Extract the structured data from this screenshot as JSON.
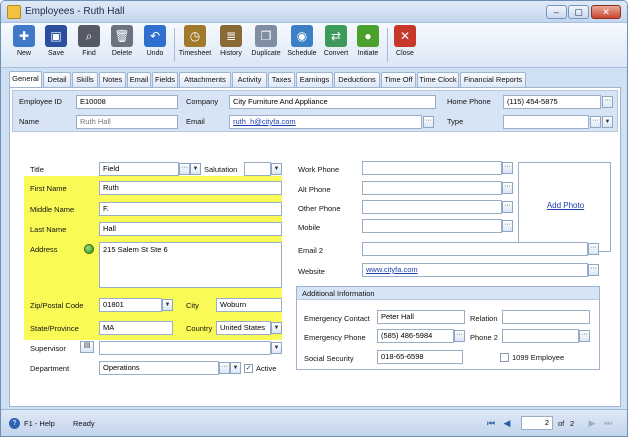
{
  "window": {
    "title": "Employees - Ruth Hall",
    "min": "–",
    "max": "▢",
    "close": "✕"
  },
  "toolbar": [
    {
      "id": "new",
      "label": "New",
      "color": "#3f79c8",
      "glyph": "✚"
    },
    {
      "id": "save",
      "label": "Save",
      "color": "#2b4f9e",
      "glyph": "▣"
    },
    {
      "id": "find",
      "label": "Find",
      "color": "#555a66",
      "glyph": "⌕"
    },
    {
      "id": "delete",
      "label": "Delete",
      "color": "#6b7280",
      "glyph": "🗑"
    },
    {
      "id": "undo",
      "label": "Undo",
      "color": "#2f6fd0",
      "glyph": "↶"
    },
    {
      "id": "timesheet",
      "label": "Timesheet",
      "color": "#a07a2a",
      "glyph": "◷"
    },
    {
      "id": "history",
      "label": "History",
      "color": "#8a6a34",
      "glyph": "≣"
    },
    {
      "id": "duplicate",
      "label": "Duplicate",
      "color": "#7f8ea3",
      "glyph": "❐"
    },
    {
      "id": "schedule",
      "label": "Schedule",
      "color": "#3b7fc4",
      "glyph": "◉"
    },
    {
      "id": "convert",
      "label": "Convert",
      "color": "#3d9a5a",
      "glyph": "⇄"
    },
    {
      "id": "initiate",
      "label": "Initiate",
      "color": "#4aa12e",
      "glyph": "●"
    },
    {
      "id": "close",
      "label": "Close",
      "color": "#c5382a",
      "glyph": "✕"
    }
  ],
  "tabs": [
    "General",
    "Detail",
    "Skills",
    "Notes",
    "Email",
    "Fields",
    "Attachments",
    "Activity",
    "Taxes",
    "Earnings",
    "Deductions",
    "Time Off",
    "Time Clock",
    "Financial Reports"
  ],
  "header": {
    "employee_id_label": "Employee ID",
    "employee_id": "E10008",
    "company_label": "Company",
    "company": "City Furniture And Appliance",
    "home_phone_label": "Home Phone",
    "home_phone": "(115) 454-5875",
    "name_label": "Name",
    "name": "Ruth Hall",
    "email_label": "Email",
    "email": "ruth_h@cityfa.com",
    "type_label": "Type",
    "type": ""
  },
  "left": {
    "title_label": "Title",
    "title": "Field",
    "salutation_label": "Salutation",
    "salutation": "",
    "first_name_label": "First Name",
    "first_name": "Ruth",
    "middle_name_label": "Middle Name",
    "middle_name": "F.",
    "last_name_label": "Last Name",
    "last_name": "Hall",
    "address_label": "Address",
    "address": "215 Salem St Ste 6",
    "zip_label": "Zip/Postal Code",
    "zip": "01801",
    "city_label": "City",
    "city": "Woburn",
    "state_label": "State/Province",
    "state": "MA",
    "country_label": "Country",
    "country": "United States",
    "supervisor_label": "Supervisor",
    "supervisor": "",
    "department_label": "Department",
    "department": "Operations",
    "active_label": "Active"
  },
  "right": {
    "work_phone_label": "Work Phone",
    "alt_phone_label": "Alt Phone",
    "other_phone_label": "Other Phone",
    "mobile_label": "Mobile",
    "email2_label": "Email 2",
    "website_label": "Website",
    "website": "www.cityfa.com",
    "add_photo": "Add Photo"
  },
  "additional": {
    "header": "Additional Information",
    "emergency_contact_label": "Emergency Contact",
    "emergency_contact": "Peter Hall",
    "relation_label": "Relation",
    "relation": "",
    "emergency_phone_label": "Emergency Phone",
    "emergency_phone": "(585) 486-5984",
    "phone2_label": "Phone 2",
    "phone2": "",
    "ssn_label": "Social Security",
    "ssn": "018-65-6598",
    "employee_1099_label": "1099 Employee"
  },
  "status": {
    "help": "F1 - Help",
    "state": "Ready",
    "page": "2",
    "of": "of",
    "total": "2"
  },
  "colors": {
    "highlight": "#fafa56",
    "link": "#1c3fb0",
    "frame": "#cfe0f3"
  }
}
